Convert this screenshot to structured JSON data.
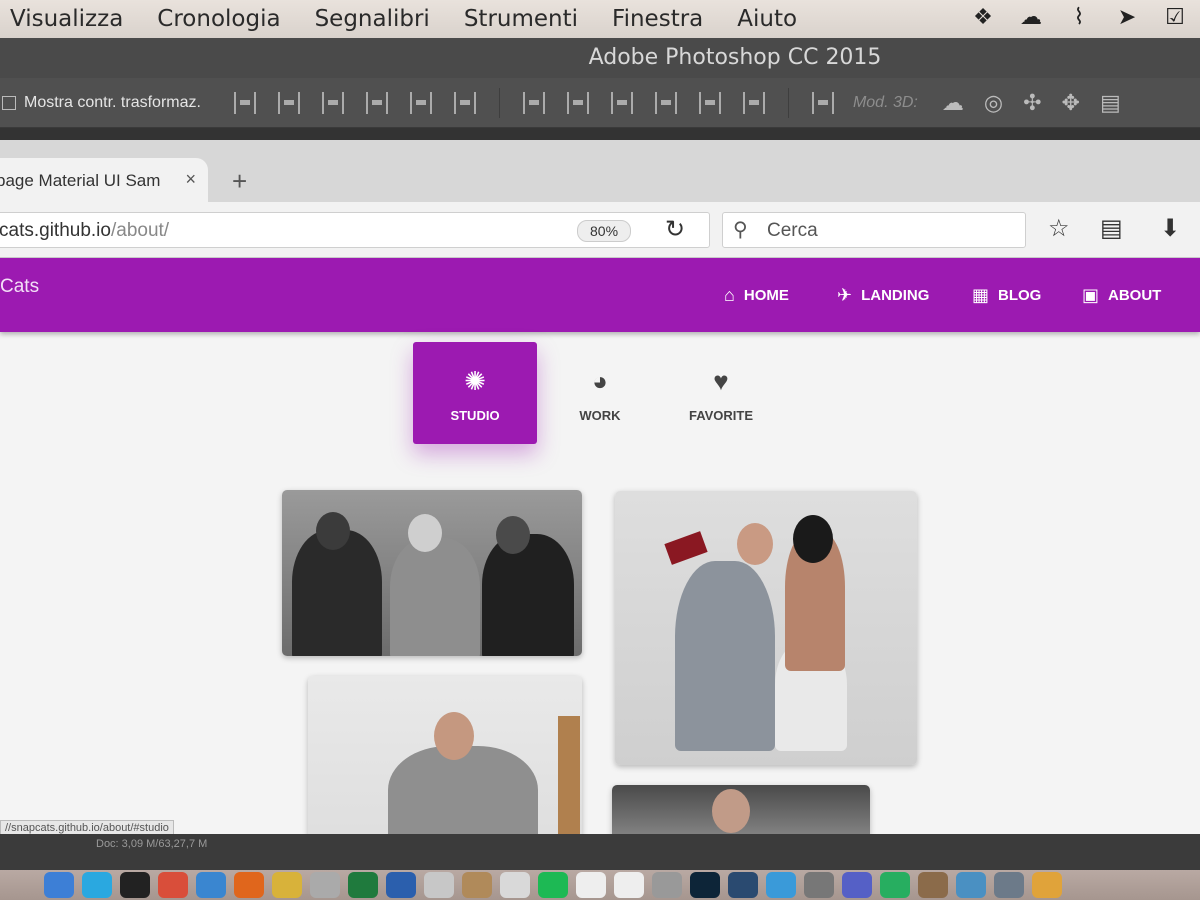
{
  "menubar": {
    "items": [
      "Visualizza",
      "Cronologia",
      "Segnalibri",
      "Strumenti",
      "Finestra",
      "Aiuto"
    ],
    "tray_icons": [
      "dropbox-icon",
      "cloud-sync-icon",
      "paperclip-icon",
      "arrow-app-icon",
      "checklist-icon"
    ]
  },
  "photoshop": {
    "title": "Adobe Photoshop CC 2015",
    "options_label": "Mostra contr. trasformaz.",
    "mode_3d_label": "Mod. 3D:",
    "doc_info": "Doc: 3,09 M/63,27,7 M"
  },
  "browser": {
    "tab_title": "page Material UI Sam",
    "tab_close": "×",
    "new_tab": "+",
    "url_host": "cats.github.io",
    "url_path": "/about/",
    "zoom": "80%",
    "search_placeholder": "Cerca",
    "status_url": "//snapcats.github.io/about/#studio"
  },
  "site": {
    "brand": "Cats",
    "accent": "#9c1ab1",
    "nav": [
      {
        "label": "HOME",
        "icon": "home-icon"
      },
      {
        "label": "LANDING",
        "icon": "flight-land-icon"
      },
      {
        "label": "BLOG",
        "icon": "dashboard-icon"
      },
      {
        "label": "ABOUT",
        "icon": "image-icon"
      }
    ],
    "tabs": [
      {
        "label": "STUDIO",
        "icon": "camera-aperture-icon",
        "active": true
      },
      {
        "label": "WORK",
        "icon": "palette-icon",
        "active": false
      },
      {
        "label": "FAVORITE",
        "icon": "heart-icon",
        "active": false
      }
    ]
  }
}
